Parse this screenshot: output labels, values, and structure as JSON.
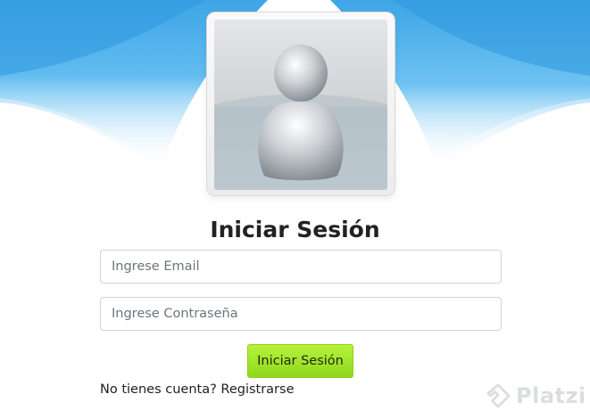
{
  "login": {
    "title": "Iniciar Sesión",
    "email_placeholder": "Ingrese Email",
    "email_value": "",
    "password_placeholder": "Ingrese Contraseña",
    "password_value": "",
    "submit_label": "Iniciar Sesión",
    "register_prompt": "No tienes cuenta?",
    "register_link": "Registrarse"
  },
  "avatar": {
    "icon": "user-avatar-icon"
  },
  "watermark": {
    "text": "Platzi",
    "icon": "platzi-logo-icon"
  },
  "colors": {
    "sky_blue": "#4aaee8",
    "button_green": "#9fe12a",
    "title_text": "#222222"
  }
}
